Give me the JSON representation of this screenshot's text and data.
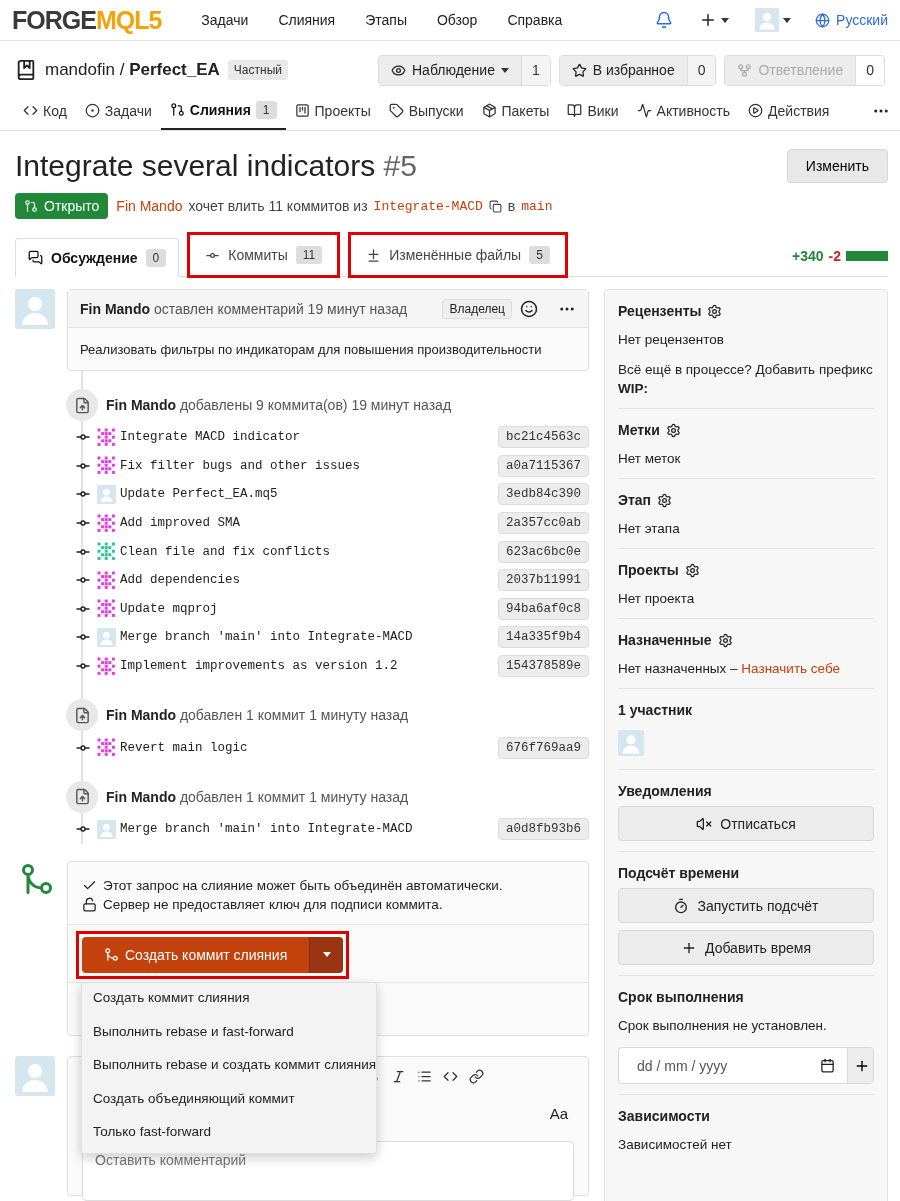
{
  "header": {
    "logo": {
      "part_1": "FORGE",
      "part_2": "MQL5"
    },
    "nav": [
      "Задачи",
      "Слияния",
      "Этапы",
      "Обзор",
      "Справка"
    ],
    "language": "Русский"
  },
  "repo": {
    "owner": "mandofin",
    "separator": "/",
    "name": "Perfect_EA",
    "visibility": "Частный",
    "buttons": [
      {
        "kind": "watch",
        "label": "Наблюдение",
        "count": "1",
        "disabled": false,
        "dropdown": true
      },
      {
        "kind": "star",
        "label": "В избранное",
        "count": "0",
        "disabled": false,
        "dropdown": false
      },
      {
        "kind": "fork",
        "label": "Ответвление",
        "count": "0",
        "disabled": true,
        "dropdown": false
      }
    ]
  },
  "repo_tabs": [
    {
      "kind": "code",
      "label": "Код",
      "selected": false
    },
    {
      "kind": "issues",
      "label": "Задачи",
      "selected": false
    },
    {
      "kind": "pulls",
      "label": "Слияния",
      "count": "1",
      "selected": true
    },
    {
      "kind": "projects",
      "label": "Проекты",
      "selected": false
    },
    {
      "kind": "releases",
      "label": "Выпуски",
      "selected": false
    },
    {
      "kind": "packages",
      "label": "Пакеты",
      "selected": false
    },
    {
      "kind": "wiki",
      "label": "Вики",
      "selected": false
    },
    {
      "kind": "activity",
      "label": "Активность",
      "selected": false
    },
    {
      "kind": "actions",
      "label": "Действия",
      "selected": false
    }
  ],
  "pull_request": {
    "title": "Integrate several indicators",
    "number": "#5",
    "edit_button": "Изменить",
    "state": "Открыто",
    "author": "Fin Mando",
    "summary": "хочет влить 11 коммитов из",
    "head_branch": "Integrate-MACD",
    "into": "в",
    "base_branch": "main"
  },
  "pr_tabs": [
    {
      "kind": "conversation",
      "label": "Обсуждение",
      "count": "0",
      "selected": true,
      "highlighted": false
    },
    {
      "kind": "commits",
      "label": "Коммиты",
      "count": "11",
      "selected": false,
      "highlighted": true
    },
    {
      "kind": "files",
      "label": "Изменённые файлы",
      "count": "5",
      "selected": false,
      "highlighted": true
    }
  ],
  "diffstat": {
    "additions": "+340",
    "deletions": "-2"
  },
  "comment": {
    "author": "Fin Mando",
    "action": "оставлен комментарий 19 минут назад",
    "role": "Владелец",
    "body": "Реализовать фильтры по индикаторам для повышения производительности"
  },
  "push_events": [
    {
      "author": "Fin Mando",
      "action": "добавлены 9 коммита(ов) 19 минут назад",
      "commits": [
        {
          "kind": "identicon",
          "color": "#e040e0",
          "message": "Integrate MACD indicator",
          "sha": "bc21c4563c"
        },
        {
          "kind": "identicon",
          "color": "#e040e0",
          "message": "Fix filter bugs and other issues",
          "sha": "a0a7115367"
        },
        {
          "kind": "default",
          "message": "Update Perfect_EA.mq5",
          "sha": "3edb84c390"
        },
        {
          "kind": "identicon",
          "color": "#e040e0",
          "message": "Add improved SMA",
          "sha": "2a357cc0ab"
        },
        {
          "kind": "identicon",
          "color": "#2ec49a",
          "message": "Clean file and fix conflicts",
          "sha": "623ac6bc0e"
        },
        {
          "kind": "identicon",
          "color": "#e040e0",
          "message": "Add dependencies",
          "sha": "2037b11991"
        },
        {
          "kind": "identicon",
          "color": "#e040e0",
          "message": "Update mqproj",
          "sha": "94ba6af0c8"
        },
        {
          "kind": "default",
          "message": "Merge branch 'main' into Integrate-MACD",
          "sha": "14a335f9b4"
        },
        {
          "kind": "identicon",
          "color": "#e040e0",
          "message": "Implement improvements as version 1.2",
          "sha": "154378589e"
        }
      ]
    },
    {
      "author": "Fin Mando",
      "action": "добавлен 1 коммит 1 минуту назад",
      "commits": [
        {
          "kind": "identicon",
          "color": "#e040e0",
          "message": "Revert main logic",
          "sha": "676f769aa9"
        }
      ]
    },
    {
      "author": "Fin Mando",
      "action": "добавлен 1 коммит 1 минуту назад",
      "commits": [
        {
          "kind": "default",
          "message": "Merge branch 'main' into Integrate-MACD",
          "sha": "a0d8fb93b6"
        }
      ]
    }
  ],
  "merge": {
    "checks": [
      {
        "kind": "check",
        "text": "Этот запрос на слияние может быть объединён автоматически."
      },
      {
        "kind": "unlock",
        "text": "Сервер не предоставляет ключ для подписи коммита."
      }
    ],
    "button": "Создать коммит слияния",
    "highlighted": true,
    "menu": {
      "open": true,
      "items": [
        "Создать коммит слияния",
        "Выполнить rebase и fast-forward",
        "Выполнить rebase и создать коммит слияния",
        "Создать объединяющий коммит",
        "Только fast-forward"
      ]
    }
  },
  "editor": {
    "font_toggle": "Aa",
    "placeholder": "Оставить комментарий"
  },
  "sidebar": [
    {
      "kind": "list",
      "title": "Рецензенты",
      "settings": true,
      "lines": [
        {
          "text": "Нет рецензентов"
        },
        {
          "text": "Всё ещё в процессе? Добавить префикс **WIP:**"
        }
      ]
    },
    {
      "kind": "list",
      "title": "Метки",
      "settings": true,
      "lines": [
        {
          "text": "Нет меток"
        }
      ]
    },
    {
      "kind": "list",
      "title": "Этап",
      "settings": true,
      "lines": [
        {
          "text": "Нет этапа"
        }
      ]
    },
    {
      "kind": "list",
      "title": "Проекты",
      "settings": true,
      "lines": [
        {
          "text": "Нет проекта"
        }
      ]
    },
    {
      "kind": "list",
      "title": "Назначенные",
      "settings": true,
      "lines": [
        {
          "text": "Нет назначенных –",
          "link": "Назначить себе"
        }
      ]
    },
    {
      "kind": "participants",
      "title": "1 участник"
    },
    {
      "kind": "buttons",
      "title": "Уведомления",
      "buttons": [
        {
          "kind": "mute",
          "label": "Отписаться"
        }
      ]
    },
    {
      "kind": "buttons",
      "title": "Подсчёт времени",
      "buttons": [
        {
          "kind": "timer",
          "label": "Запустить подсчёт"
        },
        {
          "kind": "plus",
          "label": "Добавить время"
        }
      ]
    },
    {
      "kind": "date",
      "title": "Срок выполнения",
      "lines": [
        {
          "text": "Срок выполнения не установлен."
        }
      ],
      "date_placeholder": "dd / mm / yyyy"
    },
    {
      "kind": "list",
      "title": "Зависимости",
      "lines": [
        {
          "text": "Зависимостей нет"
        }
      ]
    }
  ]
}
